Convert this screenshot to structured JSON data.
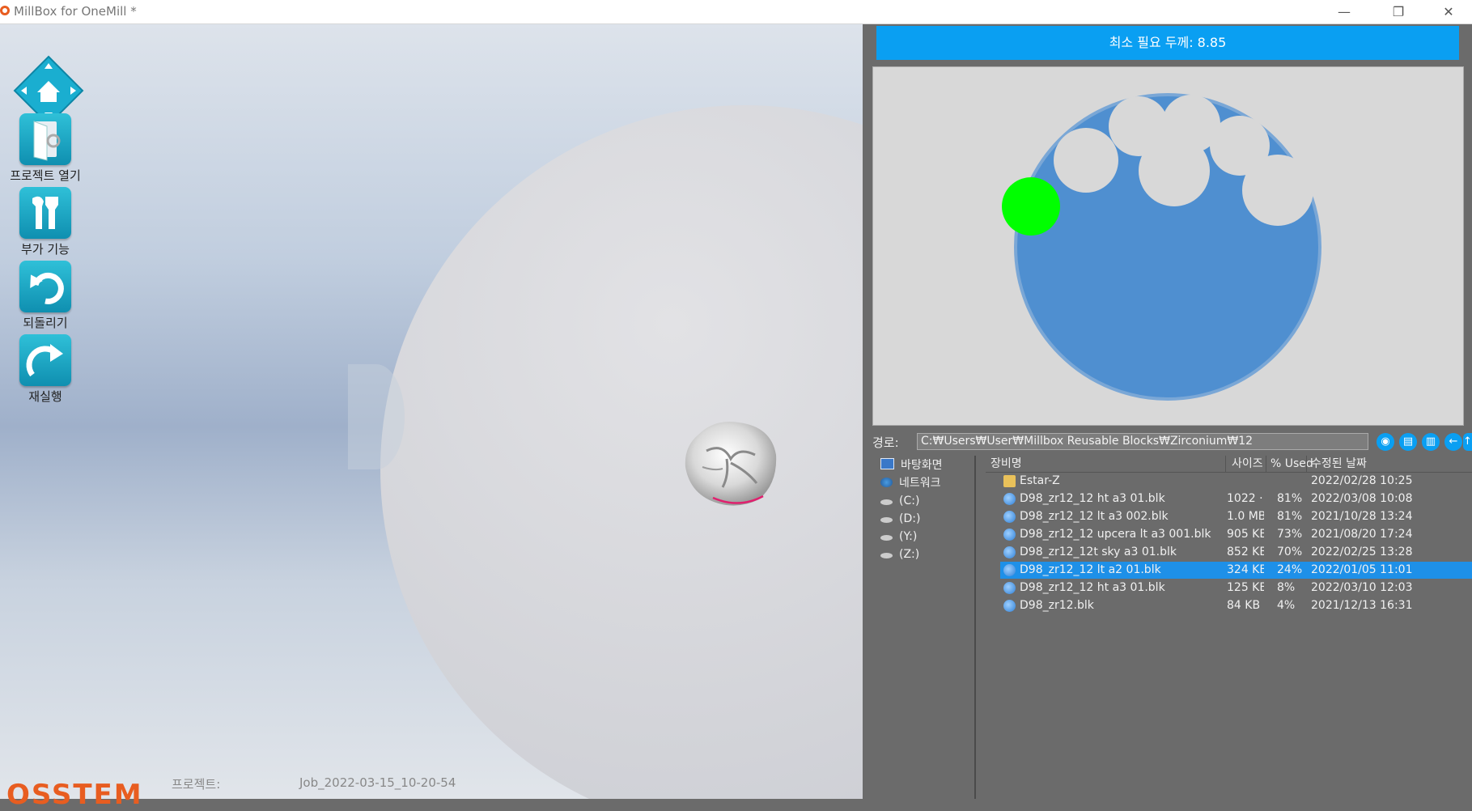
{
  "window": {
    "title": "MillBox for OneMill *",
    "minimize_glyph": "—",
    "restore_glyph": "❐",
    "close_glyph": "✕"
  },
  "toolbar": {
    "home_icon": "home-navigation-icon",
    "items": [
      {
        "label": "프로젝트 열기",
        "icon": "open-project-icon"
      },
      {
        "label": "부가 기능",
        "icon": "tools-icon"
      },
      {
        "label": "되돌리기",
        "icon": "undo-icon"
      },
      {
        "label": "재실행",
        "icon": "redo-icon"
      }
    ]
  },
  "footer": {
    "logo": "OSSTEM",
    "project_label": "프로젝트:",
    "project_value": "Job_2022-03-15_10-20-54"
  },
  "panel": {
    "min_thickness": "최소 필요 두께: 8.85",
    "path_label": "경로:",
    "path_value": "C:₩Users₩User₩Millbox Reusable Blocks₩Zirconium₩12",
    "path_buttons": [
      "eye-icon",
      "print-icon",
      "delete-icon",
      "back-arrow-icon",
      "forward-arrow-icon",
      "up-arrow-icon"
    ],
    "tree": [
      {
        "label": "바탕화면",
        "icon": "desktop-icon"
      },
      {
        "label": "네트워크",
        "icon": "network-icon"
      },
      {
        "label": "(C:)",
        "icon": "drive-icon"
      },
      {
        "label": "(D:)",
        "icon": "drive-icon"
      },
      {
        "label": "(Y:)",
        "icon": "drive-icon"
      },
      {
        "label": "(Z:)",
        "icon": "drive-icon"
      }
    ],
    "columns": {
      "name": "장비명",
      "size": "사이즈",
      "used": "% Used",
      "date": "수정된 날짜"
    },
    "rows": [
      {
        "name": "Estar-Z",
        "size": "",
        "used": "",
        "date": "2022/02/28 10:25",
        "type": "folder"
      },
      {
        "name": "D98_zr12_12  ht a3 01.blk",
        "size": "1022 ···",
        "used": "81%",
        "date": "2022/03/08 10:08",
        "type": "block"
      },
      {
        "name": "D98_zr12_12 lt a3 002.blk",
        "size": "1.0 MB",
        "used": "81%",
        "date": "2021/10/28 13:24",
        "type": "block"
      },
      {
        "name": "D98_zr12_12 upcera lt a3 001.blk",
        "size": "905 KB",
        "used": "73%",
        "date": "2021/08/20 17:24",
        "type": "block"
      },
      {
        "name": "D98_zr12_12t sky a3 01.blk",
        "size": "852 KB",
        "used": "70%",
        "date": "2022/02/25 13:28",
        "type": "block"
      },
      {
        "name": "D98_zr12_12 lt a2 01.blk",
        "size": "324 KB",
        "used": "24%",
        "date": "2022/01/05 11:01",
        "type": "block",
        "selected": true
      },
      {
        "name": "D98_zr12_12 ht a3 01.blk",
        "size": "125 KB",
        "used": "8%",
        "date": "2022/03/10 12:03",
        "type": "block"
      },
      {
        "name": "D98_zr12.blk",
        "size": "84 KB",
        "used": "4%",
        "date": "2021/12/13 16:31",
        "type": "block"
      }
    ]
  },
  "colors": {
    "accent": "#0a9ff2",
    "block_fill": "#4f8fd0",
    "placement": "#00ff00",
    "brand": "#e85d20"
  }
}
